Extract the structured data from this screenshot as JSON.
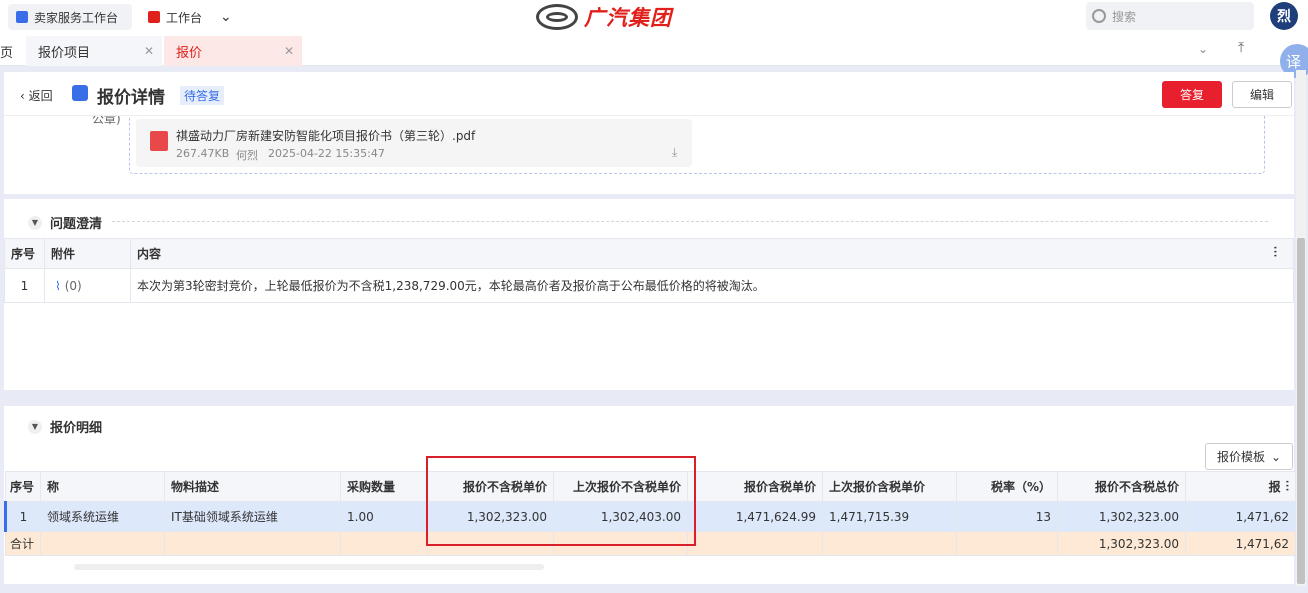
{
  "topbar": {
    "seller_workbench": "卖家服务工作台",
    "workbench": "工作台",
    "brand": "广汽集团",
    "search_placeholder": "搜索",
    "avatar_letter": "烈"
  },
  "tabs": {
    "partial": "页",
    "items": [
      {
        "label": "报价项目"
      },
      {
        "label": "报价"
      }
    ]
  },
  "translate_label": "译",
  "header": {
    "back": "返回",
    "title": "报价详情",
    "status": "待答复",
    "reply_button": "答复",
    "edit_button": "编辑"
  },
  "attachment": {
    "label_partial": "公章)",
    "filename": "祺盛动力厂房新建安防智能化项目报价书（第三轮）.pdf",
    "size": "267.47KB",
    "uploader": "何烈",
    "time": "2025-04-22 15:35:47"
  },
  "clarification": {
    "title": "问题澄清",
    "columns": [
      "序号",
      "附件",
      "内容"
    ],
    "rows": [
      {
        "no": "1",
        "attach": "(0)",
        "content": "本次为第3轮密封竞价，上轮最低报价为不含税1,238,729.00元，本轮最高价者及报价高于公布最低价格的将被淘汰。"
      }
    ]
  },
  "quote": {
    "title": "报价明细",
    "template_button": "报价模板",
    "columns": [
      "序号",
      "称",
      "物料描述",
      "采购数量",
      "报价不含税单价",
      "上次报价不含税单价",
      "报价含税单价",
      "上次报价含税单价",
      "税率（%）",
      "报价不含税总价",
      "报"
    ],
    "rows": [
      {
        "no": "1",
        "name": "领域系统运维",
        "desc": "IT基础领域系统运维",
        "qty": "1.00",
        "price_ex": "1,302,323.00",
        "last_price_ex": "1,302,403.00",
        "price_in": "1,471,624.99",
        "last_price_in": "1,471,715.39",
        "tax": "13",
        "total_ex": "1,302,323.00",
        "total_in": "1,471,62"
      }
    ],
    "total": {
      "label": "合计",
      "total_ex": "1,302,323.00",
      "total_in": "1,471,62"
    }
  },
  "colors": {
    "accent": "#e0201b",
    "primary": "#3a6ee8",
    "highlight_box": "#d9202a"
  }
}
